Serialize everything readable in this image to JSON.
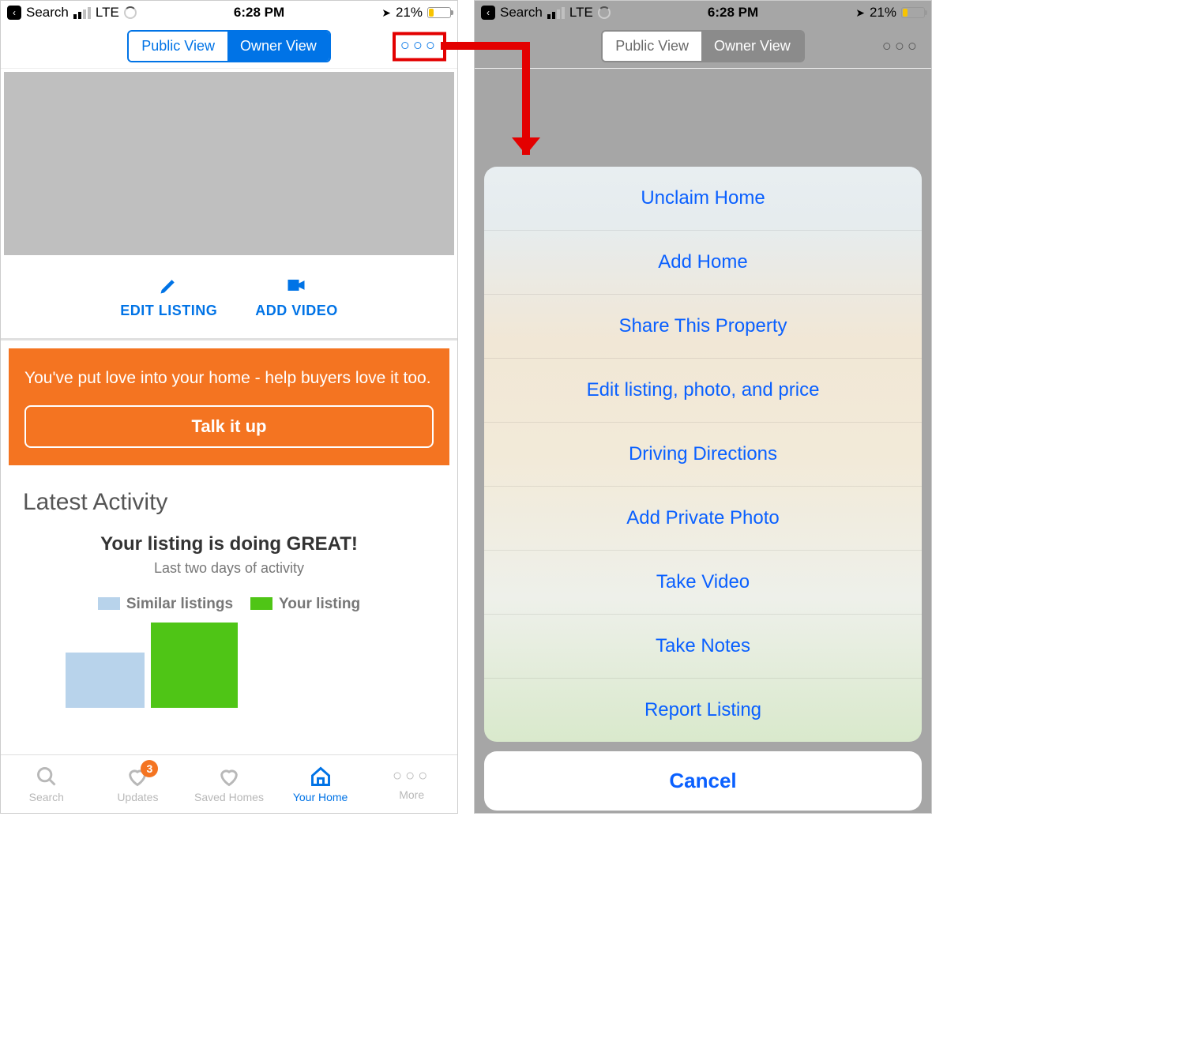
{
  "status_bar": {
    "back_label": "Search",
    "network": "LTE",
    "time": "6:28 PM",
    "battery_pct": "21%"
  },
  "segmented": {
    "public_label": "Public View",
    "owner_label": "Owner View"
  },
  "more_symbol": "○○○",
  "actions": {
    "edit_listing": "EDIT LISTING",
    "add_video": "ADD VIDEO"
  },
  "banner": {
    "text": "You've put love into your home - help buyers love it too.",
    "button": "Talk it up"
  },
  "activity": {
    "heading": "Latest Activity",
    "title": "Your listing is doing GREAT!",
    "subtitle": "Last two days of activity",
    "legend_similar": "Similar listings",
    "legend_yours": "Your listing"
  },
  "chart_data": {
    "type": "bar",
    "note": "values are relative heights; axes not labeled in source",
    "series": [
      {
        "name": "Similar listings",
        "color": "#B8D3EB",
        "values": [
          65
        ]
      },
      {
        "name": "Your listing",
        "color": "#4FC516",
        "values": [
          100
        ]
      }
    ]
  },
  "tabs": {
    "search": "Search",
    "updates": "Updates",
    "updates_badge": "3",
    "saved": "Saved Homes",
    "your_home": "Your Home",
    "more": "More"
  },
  "action_sheet": {
    "items": [
      "Unclaim Home",
      "Add Home",
      "Share This Property",
      "Edit listing, photo, and price",
      "Driving Directions",
      "Add Private Photo",
      "Take Video",
      "Take Notes",
      "Report Listing"
    ],
    "cancel": "Cancel"
  }
}
